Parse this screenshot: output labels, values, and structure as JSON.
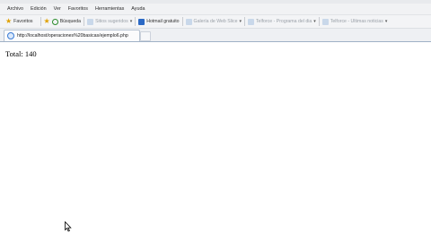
{
  "menu": [
    "Archivo",
    "Edición",
    "Ver",
    "Favoritos",
    "Herramientas",
    "Ayuda"
  ],
  "favorites_bar": {
    "favorites_label": "Favoritos",
    "items": [
      {
        "label": "Búsqueda",
        "icon": "magnifier-icon",
        "dim": false
      },
      {
        "label": "Sitios sugeridos",
        "icon": "ie-page-icon",
        "dim": true,
        "has_caret": true
      },
      {
        "label": "Hotmail gratuito",
        "icon": "msn-icon",
        "dim": false
      },
      {
        "label": "Galería de Web Slice",
        "icon": "ie-page-icon",
        "dim": true,
        "has_caret": true
      },
      {
        "label": "Telforce - Programa del dia",
        "icon": "ie-page-icon",
        "dim": true,
        "has_caret": true
      },
      {
        "label": "Telforce - Ultimas noticias",
        "icon": "ie-page-icon",
        "dim": true,
        "has_caret": true
      }
    ]
  },
  "tab": {
    "label": "http://localhost/operaciones%20basicas/ejemplo6.php"
  },
  "page": {
    "text": "Total: 140"
  }
}
